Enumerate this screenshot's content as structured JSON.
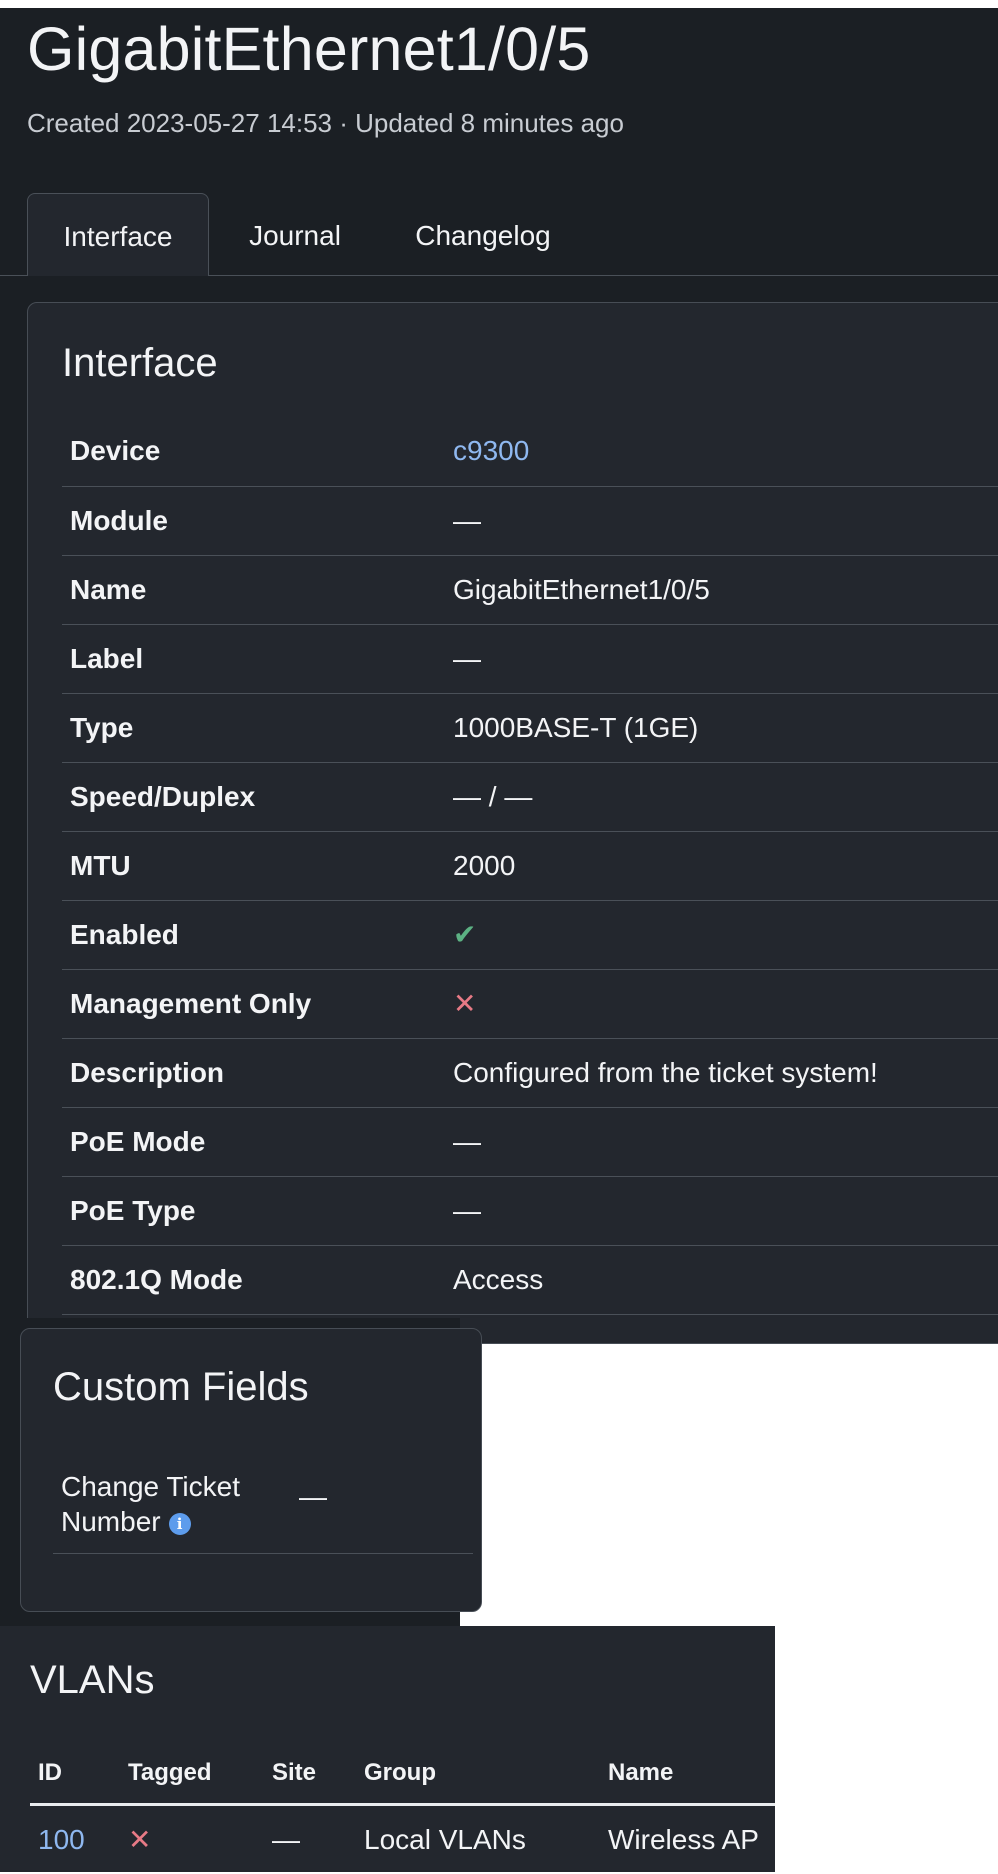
{
  "header": {
    "title": "GigabitEthernet1/0/5",
    "subtitle": "Created 2023-05-27 14:53 · Updated 8 minutes ago"
  },
  "tabs": [
    {
      "label": "Interface",
      "active": true
    },
    {
      "label": "Journal",
      "active": false
    },
    {
      "label": "Changelog",
      "active": false
    }
  ],
  "interface_card": {
    "title": "Interface",
    "rows": [
      {
        "label": "Device",
        "value": "c9300"
      },
      {
        "label": "Module",
        "value": "—"
      },
      {
        "label": "Name",
        "value": "GigabitEthernet1/0/5"
      },
      {
        "label": "Label",
        "value": "—"
      },
      {
        "label": "Type",
        "value": "1000BASE-T (1GE)"
      },
      {
        "label": "Speed/Duplex",
        "value": "— / —"
      },
      {
        "label": "MTU",
        "value": "2000"
      },
      {
        "label": "Enabled",
        "value": "✔"
      },
      {
        "label": "Management Only",
        "value": "✕"
      },
      {
        "label": "Description",
        "value": "Configured from the ticket system!"
      },
      {
        "label": "PoE Mode",
        "value": "—"
      },
      {
        "label": "PoE Type",
        "value": "—"
      },
      {
        "label": "802.1Q Mode",
        "value": "Access"
      }
    ]
  },
  "custom_fields": {
    "title": "Custom Fields",
    "label": "Change Ticket Number",
    "info_glyph": "i",
    "value": "—"
  },
  "vlans": {
    "title": "VLANs",
    "columns": [
      "ID",
      "Tagged",
      "Site",
      "Group",
      "Name"
    ],
    "rows": [
      {
        "id": "100",
        "tagged": "✕",
        "site": "—",
        "group": "Local VLANs",
        "name": "Wireless AP"
      }
    ]
  },
  "colors": {
    "page_bg": "#1b1f24",
    "card_bg": "#23272e",
    "link": "#8fb8f0",
    "success": "#5cb183",
    "danger": "#e77a86",
    "info": "#5d9cec"
  }
}
